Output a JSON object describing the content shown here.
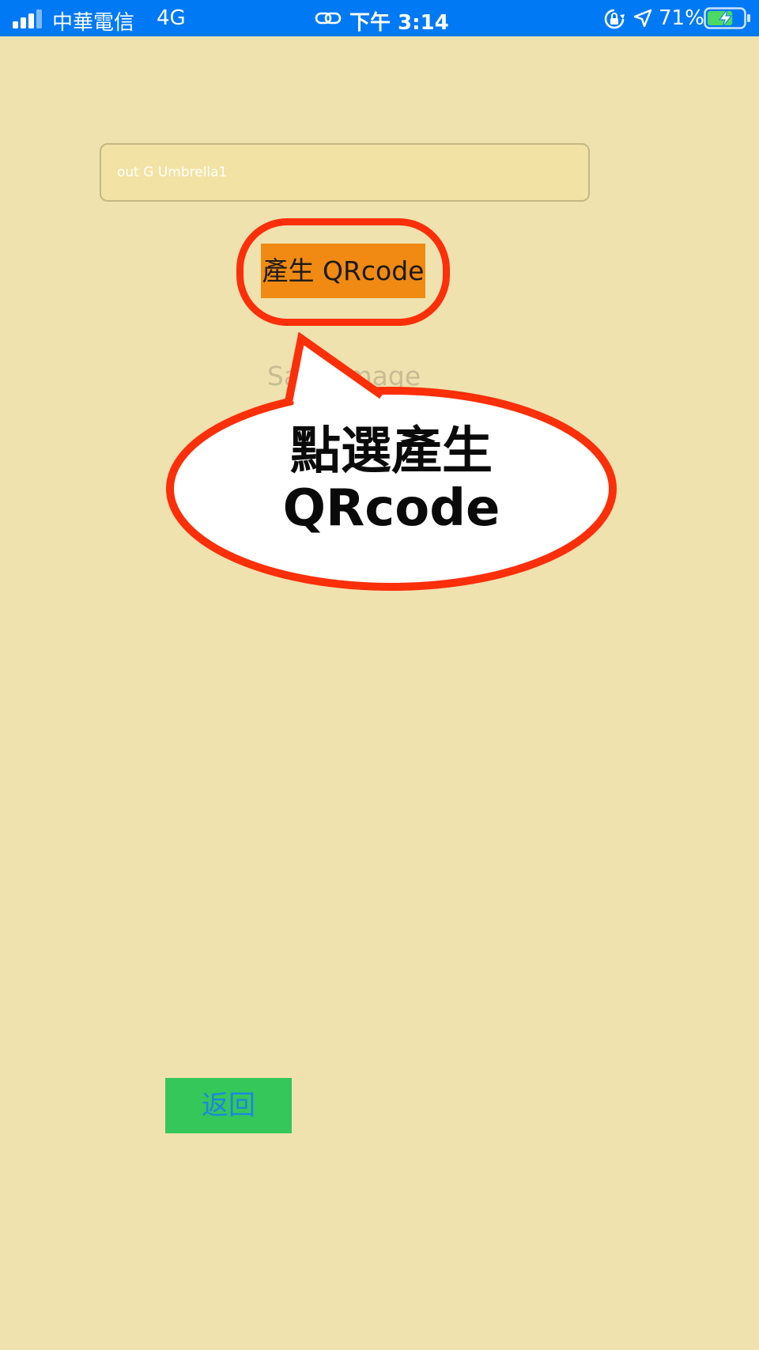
{
  "status_bar": {
    "carrier": "中華電信",
    "network": "4G",
    "time": "下午 3:14",
    "battery_percent": "71%",
    "battery_level": 0.71,
    "icons": [
      "signal-icon",
      "link-icon",
      "rotation-lock-icon",
      "location-arrow-icon",
      "battery-charging-icon"
    ],
    "background_color": "#0079f5"
  },
  "form": {
    "input_value": "out G Umbrella1",
    "generate_button_label": "產生 QRcode",
    "generate_button_color": "#f08a12",
    "save_image_label": "Save image"
  },
  "annotation": {
    "callout_line1": "點選產生",
    "callout_line2": "QRcode",
    "highlight_color": "#fb2f0a"
  },
  "footer": {
    "back_button_label": "返回",
    "back_button_color": "#35c75a"
  }
}
